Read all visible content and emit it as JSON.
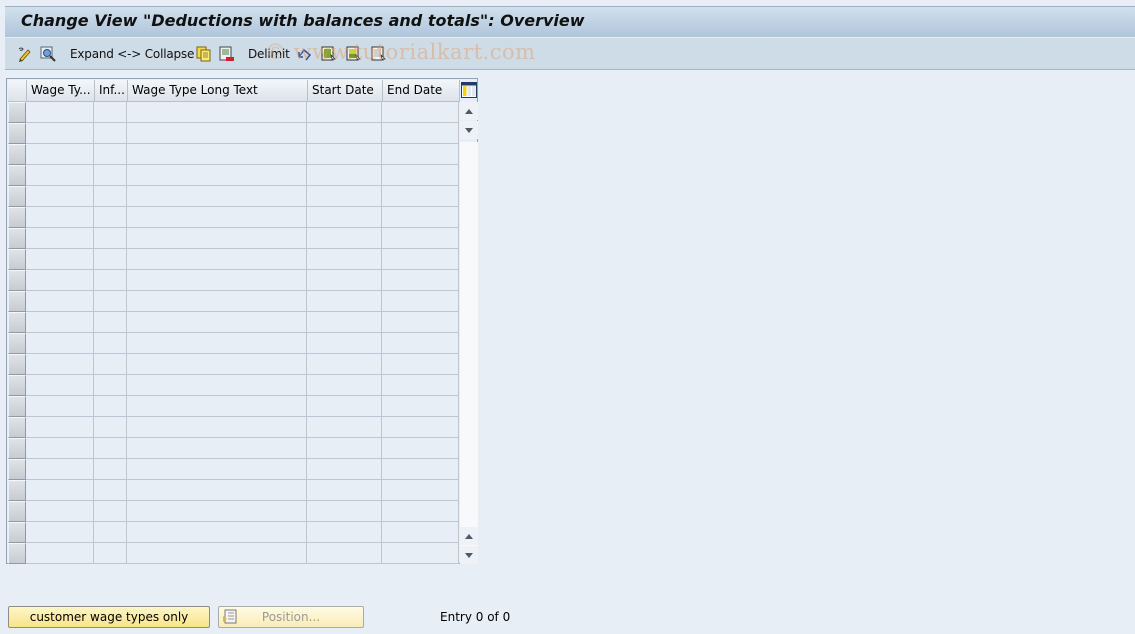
{
  "window": {
    "title": "Change View \"Deductions with balances and totals\": Overview"
  },
  "toolbar": {
    "items": [
      {
        "type": "icon",
        "name": "display-change-icon"
      },
      {
        "type": "icon",
        "name": "find-icon"
      },
      {
        "type": "text",
        "label": "Expand <-> Collapse"
      },
      {
        "type": "icon",
        "name": "copy-as-icon"
      },
      {
        "type": "icon",
        "name": "delete-icon"
      },
      {
        "type": "text",
        "label": "Delimit"
      },
      {
        "type": "icon",
        "name": "undo-change-icon"
      },
      {
        "type": "icon",
        "name": "select-all-icon"
      },
      {
        "type": "icon",
        "name": "select-block-icon"
      },
      {
        "type": "icon",
        "name": "deselect-all-icon"
      }
    ],
    "expand_collapse_label": "Expand <-> Collapse",
    "delimit_label": "Delimit"
  },
  "watermark": "© www.tutorialkart.com",
  "table": {
    "columns": [
      {
        "key": "wage_type",
        "label": "Wage Ty..."
      },
      {
        "key": "infotype",
        "label": "Inf..."
      },
      {
        "key": "long_text",
        "label": "Wage Type Long Text"
      },
      {
        "key": "start_date",
        "label": "Start Date"
      },
      {
        "key": "end_date",
        "label": "End Date"
      }
    ],
    "rows": [
      [
        "",
        "",
        "",
        "",
        ""
      ],
      [
        "",
        "",
        "",
        "",
        ""
      ],
      [
        "",
        "",
        "",
        "",
        ""
      ],
      [
        "",
        "",
        "",
        "",
        ""
      ],
      [
        "",
        "",
        "",
        "",
        ""
      ],
      [
        "",
        "",
        "",
        "",
        ""
      ],
      [
        "",
        "",
        "",
        "",
        ""
      ],
      [
        "",
        "",
        "",
        "",
        ""
      ],
      [
        "",
        "",
        "",
        "",
        ""
      ],
      [
        "",
        "",
        "",
        "",
        ""
      ],
      [
        "",
        "",
        "",
        "",
        ""
      ],
      [
        "",
        "",
        "",
        "",
        ""
      ],
      [
        "",
        "",
        "",
        "",
        ""
      ],
      [
        "",
        "",
        "",
        "",
        ""
      ],
      [
        "",
        "",
        "",
        "",
        ""
      ],
      [
        "",
        "",
        "",
        "",
        ""
      ],
      [
        "",
        "",
        "",
        "",
        ""
      ],
      [
        "",
        "",
        "",
        "",
        ""
      ],
      [
        "",
        "",
        "",
        "",
        ""
      ],
      [
        "",
        "",
        "",
        "",
        ""
      ],
      [
        "",
        "",
        "",
        "",
        ""
      ],
      [
        "",
        "",
        "",
        "",
        ""
      ]
    ]
  },
  "footer": {
    "customer_button_label": "customer wage types only",
    "position_button_label": "Position...",
    "entry_status": "Entry 0 of 0"
  }
}
